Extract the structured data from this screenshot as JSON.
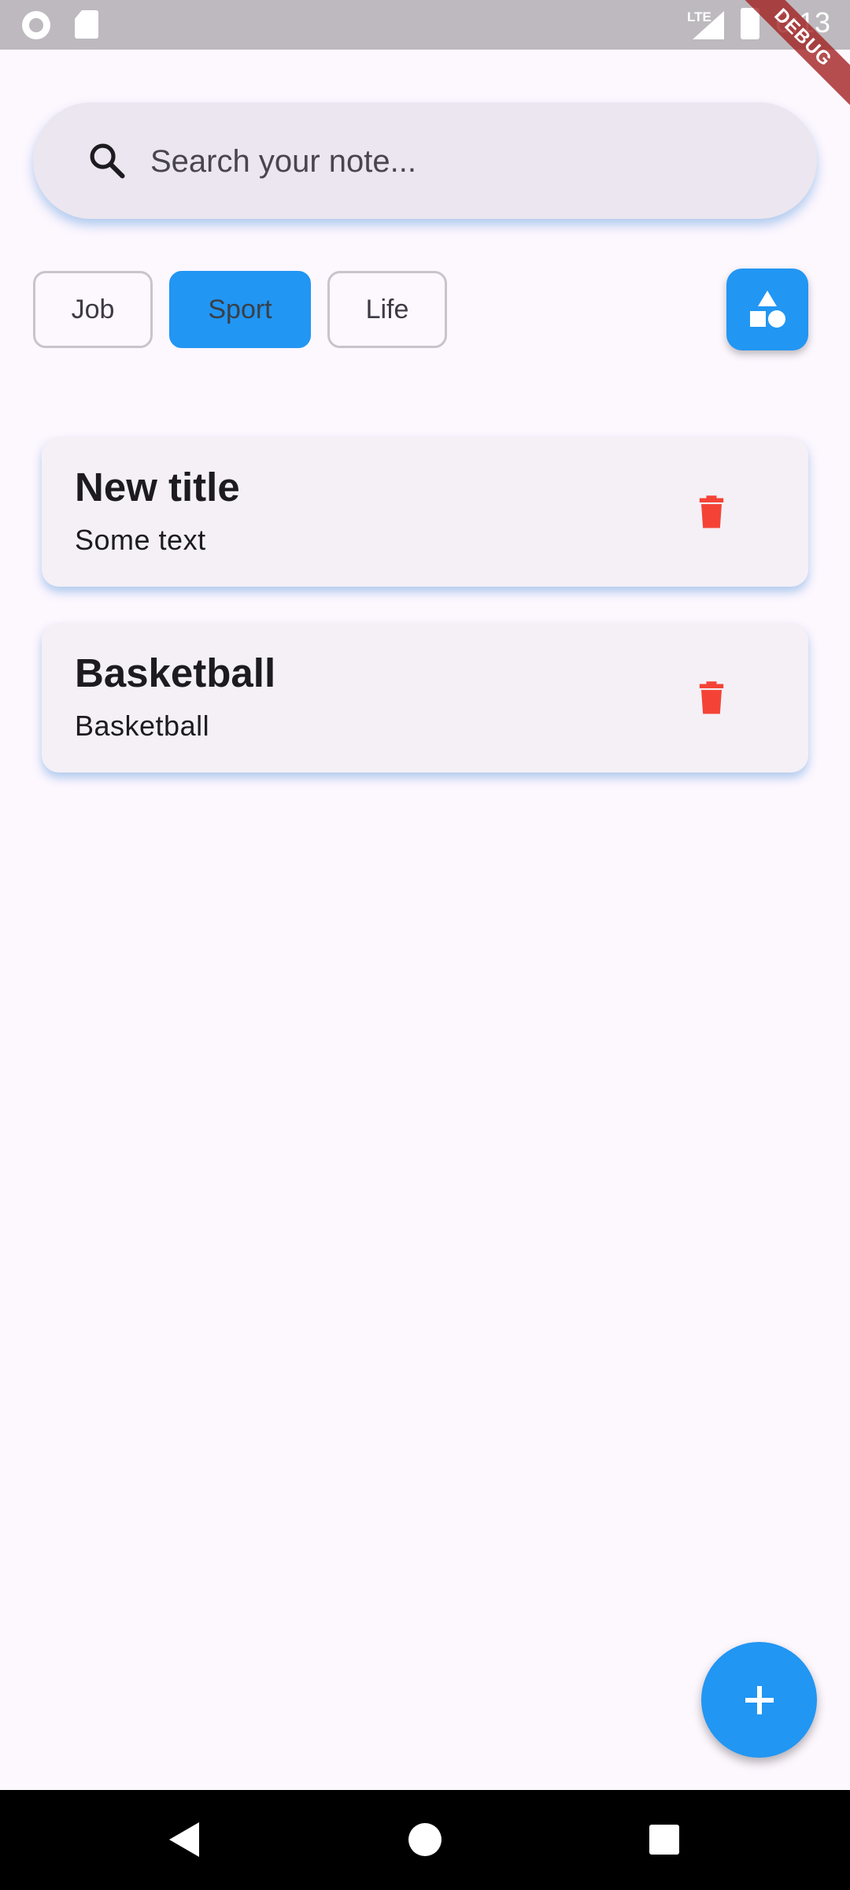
{
  "status_bar": {
    "network": "LTE",
    "time": "6:13",
    "debug_banner": "DEBUG"
  },
  "search": {
    "placeholder": "Search your note..."
  },
  "categories": [
    {
      "label": "Job",
      "selected": false
    },
    {
      "label": "Sport",
      "selected": true
    },
    {
      "label": "Life",
      "selected": false
    }
  ],
  "notes": [
    {
      "title": "New title",
      "body": "Some text"
    },
    {
      "title": "Basketball",
      "body": "Basketball"
    }
  ],
  "colors": {
    "accent": "#2196F3",
    "delete": "#F44336",
    "background": "#FDF7FE",
    "card": "#F4F0F6"
  },
  "icons": {
    "search": "search-icon",
    "shapes": "category-shapes-icon",
    "delete": "trash-icon",
    "add": "plus-icon"
  }
}
